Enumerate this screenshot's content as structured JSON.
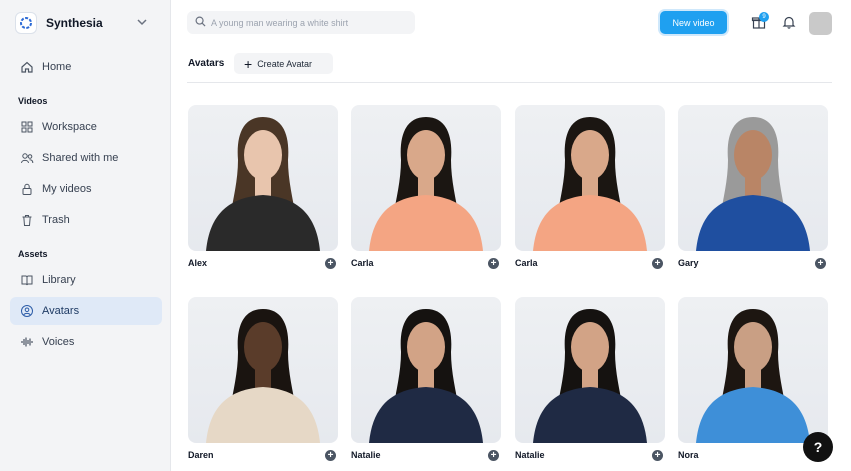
{
  "brand": {
    "name": "Synthesia"
  },
  "sidebar": {
    "items": [
      {
        "label": "Home",
        "icon": "home-icon"
      }
    ],
    "sections": [
      {
        "title": "Videos",
        "items": [
          {
            "label": "Workspace",
            "icon": "grid-icon"
          },
          {
            "label": "Shared with me",
            "icon": "users-icon"
          },
          {
            "label": "My videos",
            "icon": "lock-icon"
          },
          {
            "label": "Trash",
            "icon": "trash-icon"
          }
        ]
      },
      {
        "title": "Assets",
        "items": [
          {
            "label": "Library",
            "icon": "library-icon"
          },
          {
            "label": "Avatars",
            "icon": "avatar-icon",
            "active": true
          },
          {
            "label": "Voices",
            "icon": "waveform-icon"
          }
        ]
      }
    ]
  },
  "header": {
    "search_placeholder": "A young man wearing a white shirt",
    "new_video_label": "New video",
    "gift_badge": "9"
  },
  "page": {
    "title": "Avatars",
    "create_label": "Create Avatar"
  },
  "avatars": [
    {
      "name": "Alex",
      "top": "#2a2a2a",
      "skin": "#e8c5ad",
      "hair": "#4a3626"
    },
    {
      "name": "Carla",
      "top": "#f4a583",
      "skin": "#d9a88a",
      "hair": "#1b1612"
    },
    {
      "name": "Carla",
      "top": "#f4a583",
      "skin": "#d9a88a",
      "hair": "#1b1612"
    },
    {
      "name": "Gary",
      "top": "#1f4fa0",
      "skin": "#b98566",
      "hair": "#9a9a9a"
    },
    {
      "name": "Daren",
      "top": "#e6d8c6",
      "skin": "#5a3c2a",
      "hair": "#1a1410"
    },
    {
      "name": "Natalie",
      "top": "#1f2a44",
      "skin": "#d2a386",
      "hair": "#151210"
    },
    {
      "name": "Natalie",
      "top": "#1f2a44",
      "skin": "#d2a386",
      "hair": "#151210"
    },
    {
      "name": "Nora",
      "top": "#3e8fd8",
      "skin": "#c99f84",
      "hair": "#1d1611"
    }
  ],
  "colors": {
    "accent": "#1fa0f0",
    "active_nav": "#dfe9f7"
  }
}
